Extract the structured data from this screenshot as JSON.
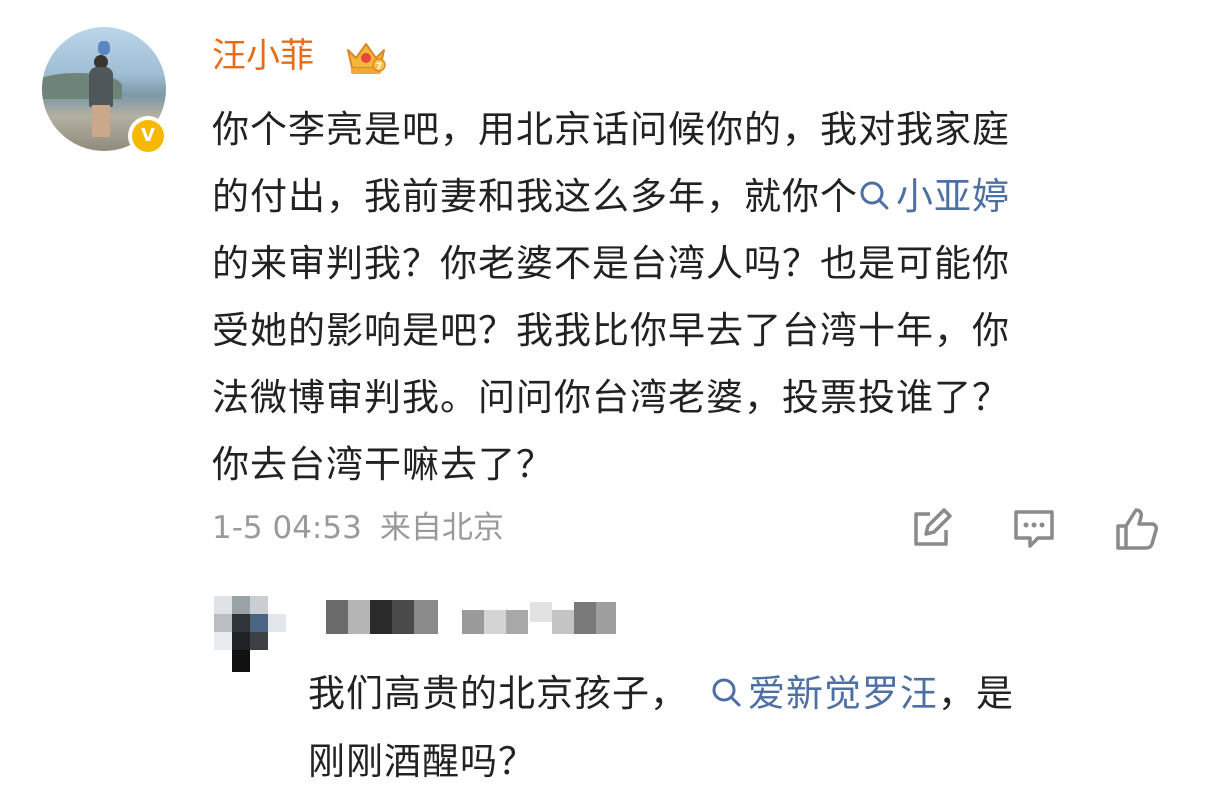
{
  "post": {
    "username": "汪小菲",
    "lines": [
      "你个李亮是吧，用北京话问候你的，我对我家庭",
      "的付出，我前妻和我这么多年，就你个",
      "的来审判我？你老婆不是台湾人吗？也是可能你",
      "受她的影响是吧？我我比你早去了台湾十年，你",
      "法微博审判我。问问你台湾老婆，投票投谁了？",
      "你去台湾干嘛去了？"
    ],
    "topic_1": "小亚婷",
    "time": "1-5 04:53",
    "source": "来自北京"
  },
  "reply": {
    "text_before": "我们高贵的北京孩子，",
    "topic": "爱新觉罗汪",
    "text_after": "，是",
    "line2": "刚刚酒醒吗？"
  },
  "colors": {
    "username": "#e86b17",
    "topic": "#4e6fa3",
    "meta": "#9a9a9a",
    "verified_badge": "#f6b900"
  },
  "icons": {
    "verified": "v-verified-icon",
    "crown": "crown-vip-icon",
    "topic": "search-icon",
    "repost": "repost-icon",
    "comment": "comment-icon",
    "like": "like-icon"
  }
}
